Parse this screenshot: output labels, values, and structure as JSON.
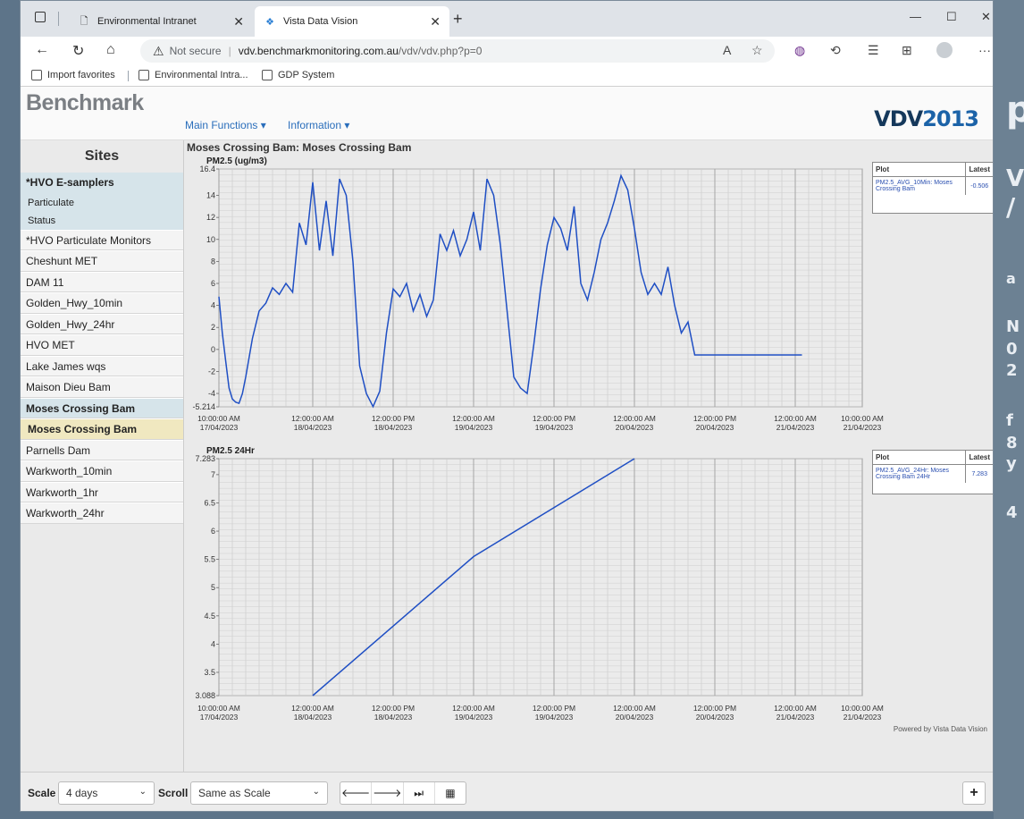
{
  "browser": {
    "tabs": [
      {
        "title": "Environmental Intranet"
      },
      {
        "title": "Vista Data Vision"
      }
    ],
    "address": {
      "security": "Not secure",
      "host": "vdv.benchmarkmonitoring.com.au",
      "path": "/vdv/vdv.php?p=0"
    },
    "favorites": [
      "Import favorites",
      "Environmental Intra...",
      "GDP System"
    ]
  },
  "header": {
    "logo": "Benchmark",
    "menu": [
      "Main Functions ▾",
      "Information ▾"
    ],
    "brand_a": "VDV",
    "brand_b": "2013"
  },
  "sidebar": {
    "title": "Sites",
    "items": [
      {
        "label": "*HVO E-samplers"
      },
      {
        "label": "Particulate"
      },
      {
        "label": "Status"
      },
      {
        "label": "*HVO Particulate Monitors"
      },
      {
        "label": "Cheshunt MET"
      },
      {
        "label": "DAM 11"
      },
      {
        "label": "Golden_Hwy_10min"
      },
      {
        "label": "Golden_Hwy_24hr"
      },
      {
        "label": "HVO MET"
      },
      {
        "label": "Lake James wqs"
      },
      {
        "label": "Maison Dieu Bam"
      },
      {
        "label": "Moses Crossing Bam"
      },
      {
        "label": "Moses Crossing Bam"
      },
      {
        "label": "Parnells Dam"
      },
      {
        "label": "Warkworth_10min"
      },
      {
        "label": "Warkworth_1hr"
      },
      {
        "label": "Warkworth_24hr"
      }
    ]
  },
  "main": {
    "site_title": "Moses Crossing Bam: Moses Crossing Bam",
    "powered": "Powered by Vista Data Vision"
  },
  "legend_headers": {
    "plot": "Plot",
    "latest": "Latest"
  },
  "chart_data": [
    {
      "type": "line",
      "title": "PM2.5 (ug/m3)",
      "ylim": [
        -5.214,
        16.4
      ],
      "ytick_labels": [
        "16.4",
        "14",
        "12",
        "10",
        "8",
        "6",
        "4",
        "2",
        "0",
        "-2",
        "-4",
        "-5.214"
      ],
      "x_tick_labels": [
        [
          "10:00:00 AM",
          "17/04/2023"
        ],
        [
          "12:00:00 AM",
          "18/04/2023"
        ],
        [
          "12:00:00 PM",
          "18/04/2023"
        ],
        [
          "12:00:00 AM",
          "19/04/2023"
        ],
        [
          "12:00:00 PM",
          "19/04/2023"
        ],
        [
          "12:00:00 AM",
          "20/04/2023"
        ],
        [
          "12:00:00 PM",
          "20/04/2023"
        ],
        [
          "12:00:00 AM",
          "21/04/2023"
        ],
        [
          "10:00:00 AM",
          "21/04/2023"
        ]
      ],
      "grid": true,
      "series": [
        {
          "name": "PM2.5_AVG_10Min: Moses Crossing Bam",
          "latest": "-0.506",
          "x_hours": [
            0,
            0.5,
            1,
            1.5,
            2,
            2.5,
            3,
            3.5,
            4,
            5,
            6,
            7,
            8,
            9,
            10,
            11,
            12,
            13,
            14,
            15,
            16,
            17,
            17.5,
            18,
            19,
            20,
            21,
            22,
            23,
            24,
            25,
            26,
            27,
            28,
            29,
            30,
            31,
            32,
            33,
            34,
            35,
            36,
            37,
            38,
            39,
            40,
            41,
            42,
            43,
            44,
            45,
            46,
            47,
            48,
            49,
            50,
            51,
            52,
            53,
            54,
            55,
            56,
            57,
            58,
            59,
            60,
            61,
            62,
            63,
            64,
            65,
            66,
            67,
            68,
            69,
            70,
            71,
            72,
            73,
            74,
            75,
            76,
            77,
            78,
            79,
            80,
            81,
            82,
            83,
            84,
            85,
            86,
            87
          ],
          "values": [
            4.8,
            1.5,
            -1.0,
            -3.5,
            -4.5,
            -4.8,
            -4.9,
            -4.0,
            -2.5,
            1.0,
            3.5,
            4.2,
            5.6,
            5.0,
            6.0,
            5.2,
            11.5,
            9.5,
            15.2,
            9.0,
            13.5,
            8.5,
            12.0,
            15.5,
            14.0,
            8.0,
            -1.5,
            -4.0,
            -5.2,
            -3.8,
            1.5,
            5.5,
            4.8,
            6.0,
            3.5,
            5.0,
            3.0,
            4.5,
            10.5,
            9.0,
            10.8,
            8.5,
            10.0,
            12.5,
            9.0,
            15.5,
            14.0,
            9.5,
            3.5,
            -2.5,
            -3.5,
            -4.0,
            0.5,
            5.5,
            9.5,
            12.0,
            11.0,
            9.0,
            13.0,
            6.0,
            4.5,
            7.0,
            10.0,
            11.5,
            13.5,
            15.8,
            14.5,
            11.0,
            7.0,
            5.0,
            6.0,
            5.0,
            7.5,
            4.0,
            1.5,
            2.5,
            -0.5,
            -0.5,
            -0.5,
            -0.5,
            -0.5,
            -0.5,
            -0.5,
            -0.5,
            -0.5,
            -0.5,
            -0.5,
            -0.5,
            -0.5,
            -0.5,
            -0.5,
            -0.5,
            -0.5
          ]
        }
      ]
    },
    {
      "type": "line",
      "title": "PM2.5 24Hr",
      "ylim": [
        3.088,
        7.283
      ],
      "ytick_labels": [
        "7.283",
        "7",
        "6.5",
        "6",
        "5.5",
        "5",
        "4.5",
        "4",
        "3.5",
        "3.088"
      ],
      "x_tick_labels": [
        [
          "10:00:00 AM",
          "17/04/2023"
        ],
        [
          "12:00:00 AM",
          "18/04/2023"
        ],
        [
          "12:00:00 PM",
          "18/04/2023"
        ],
        [
          "12:00:00 AM",
          "19/04/2023"
        ],
        [
          "12:00:00 PM",
          "19/04/2023"
        ],
        [
          "12:00:00 AM",
          "20/04/2023"
        ],
        [
          "12:00:00 PM",
          "20/04/2023"
        ],
        [
          "12:00:00 AM",
          "21/04/2023"
        ],
        [
          "10:00:00 AM",
          "21/04/2023"
        ]
      ],
      "grid": true,
      "series": [
        {
          "name": "PM2.5_AVG_24Hr: Moses Crossing Bam 24Hr",
          "latest": "7.283",
          "x_hours": [
            14,
            38,
            62
          ],
          "values": [
            3.088,
            5.55,
            7.283
          ]
        }
      ]
    }
  ],
  "footer": {
    "scale_label": "Scale",
    "scale_value": "4 days",
    "scroll_label": "Scroll",
    "scroll_value": "Same as Scale",
    "controls": [
      "🡐",
      "🡒",
      "⏭",
      "▦"
    ],
    "plus": "+"
  }
}
